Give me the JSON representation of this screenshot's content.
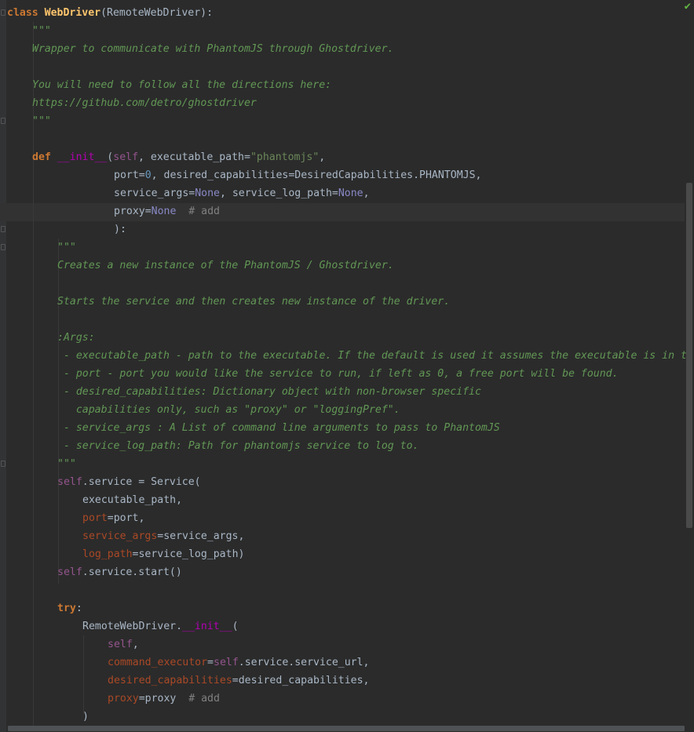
{
  "status": {
    "ok_icon": "check-icon",
    "ok_color": "#62b543"
  },
  "code": {
    "l1_kw": "class ",
    "l1_name": "WebDriver",
    "l1_rest": "(RemoteWebDriver):",
    "l2": "\"\"\"",
    "l3": "Wrapper to communicate with PhantomJS through Ghostdriver.",
    "l5": "You will need to follow all the directions here:",
    "l6": "https://github.com/detro/ghostdriver",
    "l7": "\"\"\"",
    "l9_kw": "def ",
    "l9_fn": "__init__",
    "l9_p1": "(",
    "l9_self": "self",
    "l9_p2": ", executable_path=",
    "l9_str": "\"phantomjs\"",
    "l9_p3": ",",
    "l10_a": "port=",
    "l10_num": "0",
    "l10_b": ", desired_capabilities=DesiredCapabilities.PHANTOMJS,",
    "l11_a": "service_args=",
    "l11_none1": "None",
    "l11_b": ", service_log_path=",
    "l11_none2": "None",
    "l11_c": ",",
    "l12_a": "proxy=",
    "l12_none": "None",
    "l12_comment": "  # add",
    "l13": "):",
    "l14": "\"\"\"",
    "l15": "Creates a new instance of the PhantomJS / Ghostdriver.",
    "l17": "Starts the service and then creates new instance of the driver.",
    "l19": ":Args:",
    "l20": " - executable_path - path to the executable. If the default is used it assumes the executable is in t",
    "l21": " - port - port you would like the service to run, if left as 0, a free port will be found.",
    "l22": " - desired_capabilities: Dictionary object with non-browser specific",
    "l23": "   capabilities only, such as \"proxy\" or \"loggingPref\".",
    "l24": " - service_args : A List of command line arguments to pass to PhantomJS",
    "l25": " - service_log_path: Path for phantomjs service to log to.",
    "l26": "\"\"\"",
    "l27_self": "self",
    "l27_rest": ".service = Service(",
    "l28": "executable_path,",
    "l29_kw": "port",
    "l29_rest": "=port,",
    "l30_kw": "service_args",
    "l30_rest": "=service_args,",
    "l31_kw": "log_path",
    "l31_rest": "=service_log_path)",
    "l32_self": "self",
    "l32_rest": ".service.start()",
    "l34_kw": "try",
    "l34_rest": ":",
    "l35_a": "RemoteWebDriver.",
    "l35_fn": "__init__",
    "l35_b": "(",
    "l36_self": "self",
    "l36_rest": ",",
    "l37_kw": "command_executor",
    "l37_eq": "=",
    "l37_self": "self",
    "l37_rest": ".service.service_url,",
    "l38_kw": "desired_capabilities",
    "l38_rest": "=desired_capabilities,",
    "l39_kw": "proxy",
    "l39_rest": "=proxy",
    "l39_comment": "  # add",
    "l40": ")"
  }
}
